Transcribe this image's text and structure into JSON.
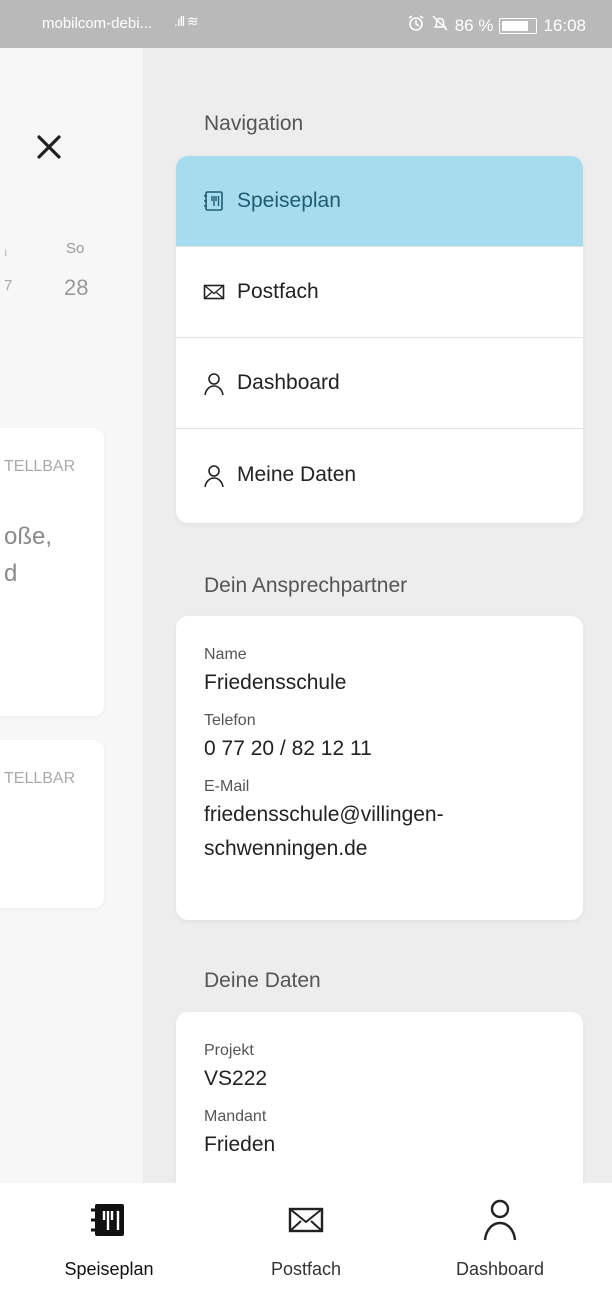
{
  "status_bar": {
    "carrier": "mobilcom-debi...",
    "signal": ".ıll ≋",
    "battery_percent": "86 %",
    "time": "16:08",
    "icons": [
      "alarm-icon",
      "bell-off-icon",
      "battery-icon"
    ]
  },
  "background": {
    "day_label": "So",
    "date": "28",
    "marker_top": "ı",
    "marker_date": "7",
    "card1_status": "TELLBAR",
    "card1_text_line1": "oße,",
    "card1_text_line2": "d",
    "card2_status": "TELLBAR",
    "close_icon": "close-icon"
  },
  "drawer": {
    "navigation_title": "Navigation",
    "nav_items": [
      {
        "label": "Speiseplan",
        "icon": "menu-book-icon",
        "active": true
      },
      {
        "label": "Postfach",
        "icon": "envelope-icon",
        "active": false
      },
      {
        "label": "Dashboard",
        "icon": "person-icon",
        "active": false
      },
      {
        "label": "Meine Daten",
        "icon": "person-icon",
        "active": false
      }
    ],
    "contact_title": "Dein Ansprechpartner",
    "contact": {
      "name_label": "Name",
      "name": "Friedensschule",
      "phone_label": "Telefon",
      "phone": "0 77 20 / 82 12 11",
      "email_label": "E-Mail",
      "email_line1": "friedensschule@villingen-",
      "email_line2": "schwenningen.de"
    },
    "data_title": "Deine Daten",
    "data": {
      "project_label": "Projekt",
      "project": "VS222",
      "client_label": "Mandant",
      "client": "Frieden"
    }
  },
  "bottom_nav": {
    "tabs": [
      {
        "label": "Speiseplan",
        "icon": "menu-book-icon",
        "active": true
      },
      {
        "label": "Postfach",
        "icon": "envelope-icon",
        "active": false
      },
      {
        "label": "Dashboard",
        "icon": "person-icon",
        "active": false
      }
    ]
  },
  "colors": {
    "accent": "#a7dcef",
    "status_bar": "#b9b9b9",
    "drawer_bg": "#ededed"
  }
}
